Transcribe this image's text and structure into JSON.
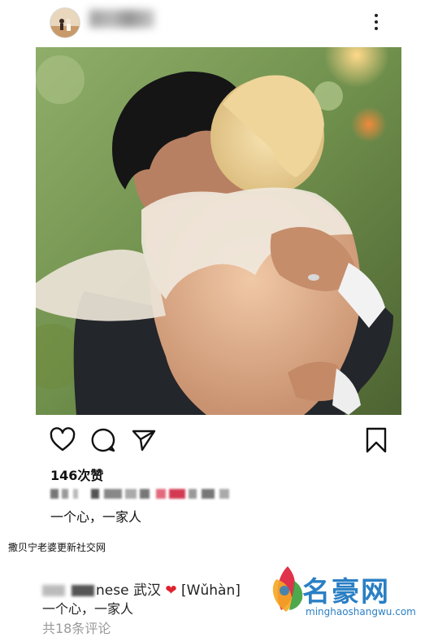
{
  "post": {
    "likes_text": "146次赞",
    "caption": "一个心，一家人"
  },
  "article_note": "撒贝宁老婆更新社交网",
  "comment": {
    "name_suffix": "nese",
    "location": "武汉",
    "heart": "❤",
    "pinyin": "[Wǔhàn]",
    "text": "一个心，一家人",
    "count_text": "共18条评论"
  },
  "watermark": {
    "brand": "名豪网",
    "url": "minghaoshangwu.com"
  },
  "icons": {
    "like": "heart-outline-icon",
    "comment": "speech-bubble-icon",
    "share": "paper-plane-icon",
    "save": "bookmark-icon",
    "more": "vertical-ellipsis-icon"
  },
  "colors": {
    "watermark_blue": "#2a7fc4",
    "heart_red": "#e0222e",
    "muted_text": "#999999"
  }
}
